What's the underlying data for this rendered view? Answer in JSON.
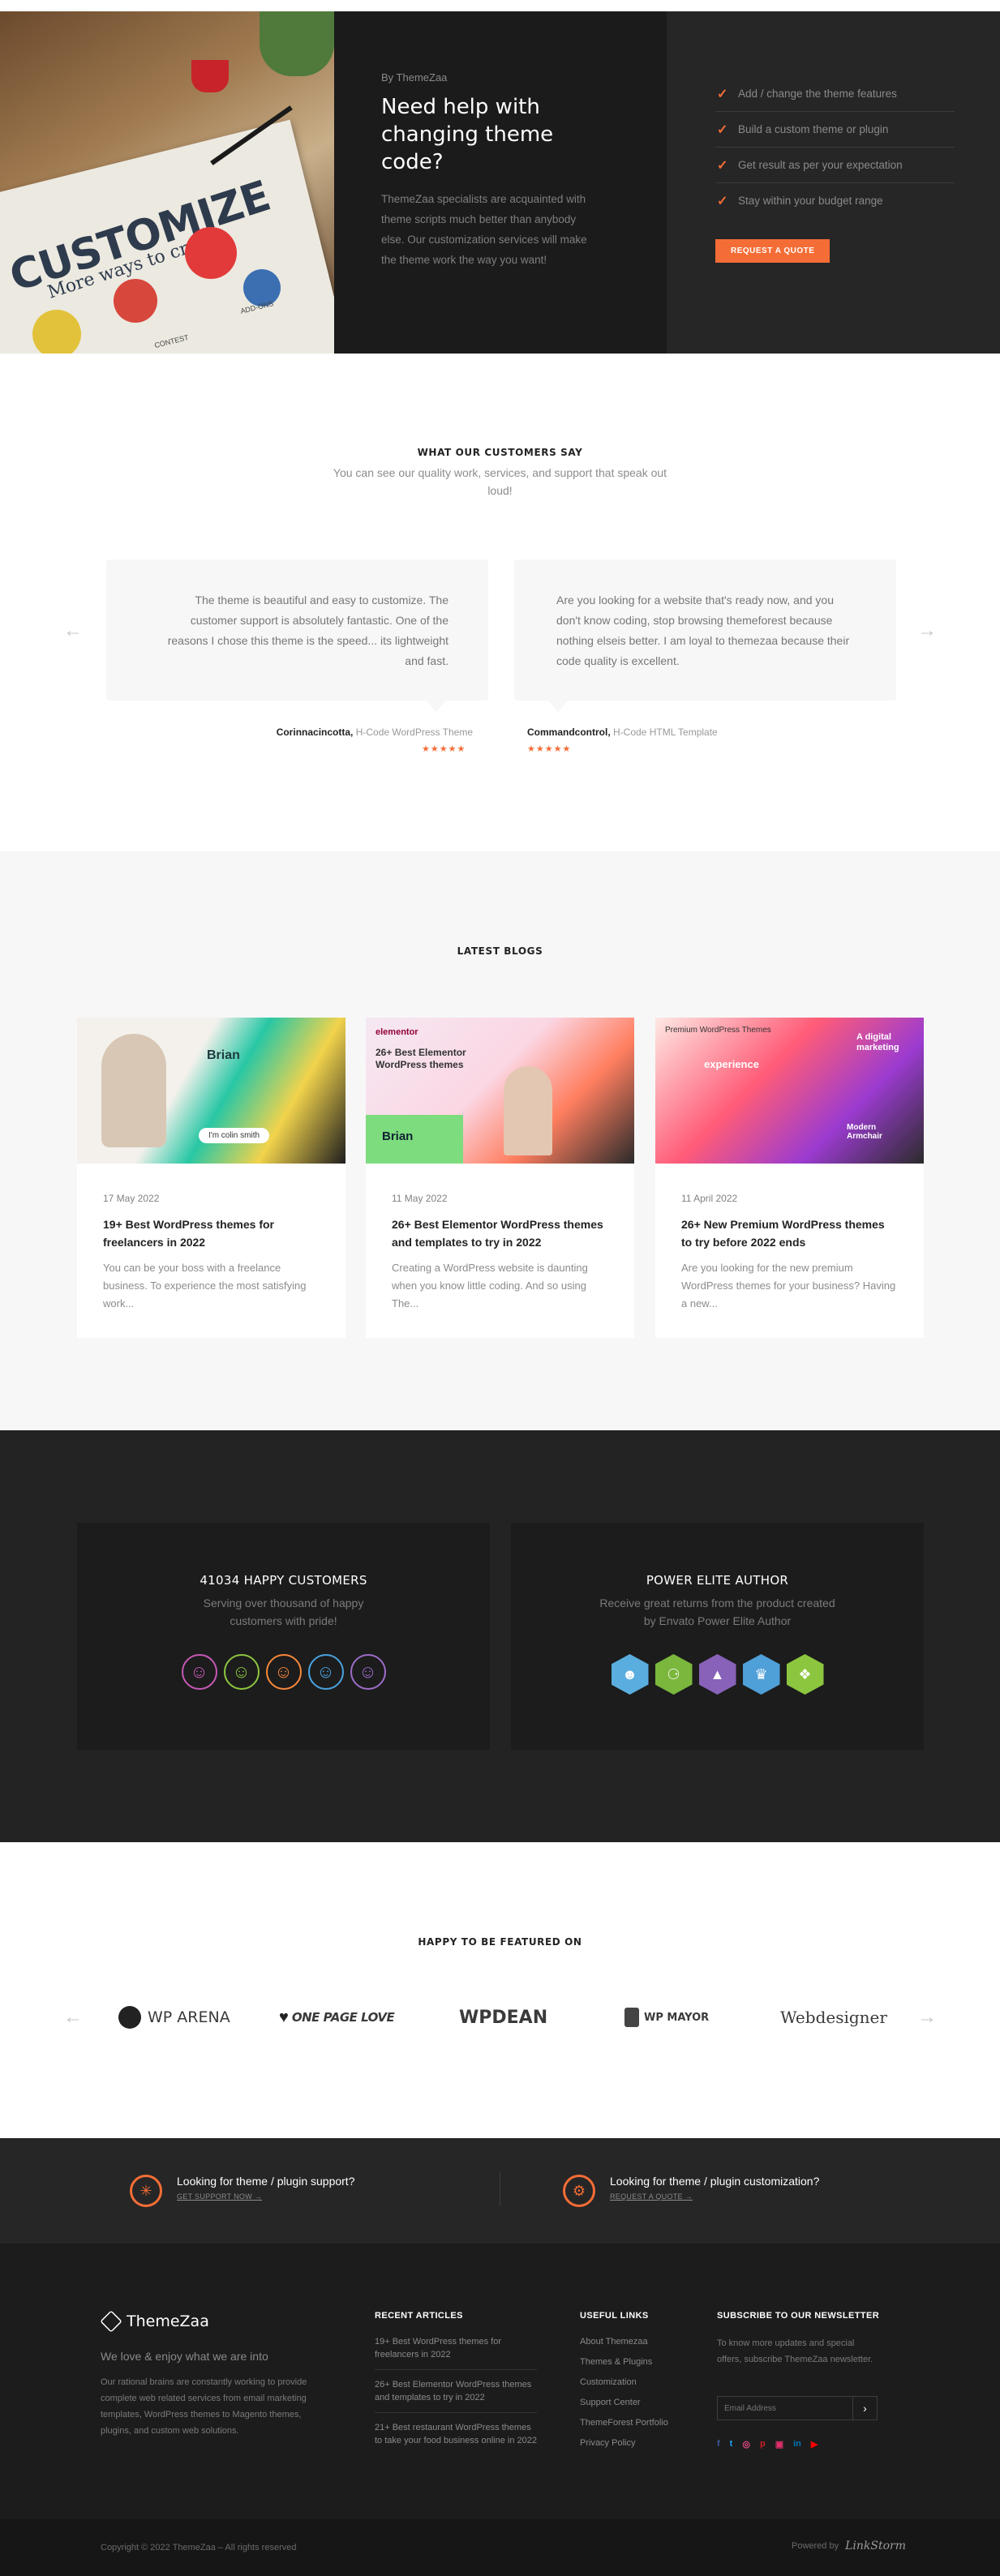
{
  "hero": {
    "image_text": {
      "big": "CUSTOMIZE",
      "small": "More ways to create",
      "addons": "ADD-ONS",
      "contest": "CONTEST"
    },
    "byline": "By ThemeZaa",
    "title": "Need help with changing theme code?",
    "description": "ThemeZaa specialists are acquainted with theme scripts much better than anybody else. Our customization services will make the theme work the way you want!",
    "features": [
      "Add / change the theme features",
      "Build a custom theme or plugin",
      "Get result as per your expectation",
      "Stay within your budget range"
    ],
    "cta": "REQUEST A QUOTE",
    "accent": "#f46d36"
  },
  "testimonials": {
    "heading": "WHAT OUR CUSTOMERS SAY",
    "subheading": "You can see our quality work, services, and support that speak out loud!",
    "items": [
      {
        "text": "The theme is beautiful and easy to customize. The customer support is absolutely fantastic. One of the reasons I chose this theme is the speed... its lightweight and fast.",
        "name": "Corinnacincotta,",
        "product": "H-Code WordPress Theme",
        "stars": "★★★★★"
      },
      {
        "text": "Are you looking for a website that's ready now, and you don't know coding, stop browsing themeforest because nothing elseis better. I am loyal to themezaa because their code quality is excellent.",
        "name": "Commandcontrol,",
        "product": "H-Code HTML Template",
        "stars": "★★★★★"
      }
    ],
    "prev_icon": "arrow-left-icon",
    "next_icon": "arrow-right-icon"
  },
  "blogs": {
    "heading": "LATEST BLOGS",
    "posts": [
      {
        "date": "17 May 2022",
        "title": "19+ Best WordPress themes for freelancers in 2022",
        "excerpt": "You can be your boss with a freelance business. To experience the most satisfying work...",
        "img_label": "Brian",
        "img_label2": "I'm colin smith"
      },
      {
        "date": "11 May 2022",
        "title": "26+ Best Elementor WordPress themes and templates to try in 2022",
        "excerpt": "Creating a WordPress website is daunting when you know little coding. And so using The...",
        "img_label": "elementor",
        "img_label2": "26+ Best Elementor WordPress themes",
        "img_label3": "Brian"
      },
      {
        "date": "11 April 2022",
        "title": "26+ New Premium WordPress themes to try before 2022 ends",
        "excerpt": "Are you looking for the new premium WordPress themes for your business? Having a new...",
        "img_label": "Premium WordPress Themes",
        "img_label2": "experience",
        "img_label3": "A digital marketing",
        "img_label4": "Modern Armchair"
      }
    ]
  },
  "stats": {
    "customers": {
      "title": "41034 HAPPY CUSTOMERS",
      "subtitle": "Serving over thousand of happy customers with pride!",
      "icons": [
        "face-cool-icon",
        "face-smile-icon",
        "face-grin-icon",
        "face-mustache-icon",
        "face-wink-icon"
      ],
      "colors": [
        "#c559b5",
        "#8dc63f",
        "#f6883c",
        "#4aa3df",
        "#9b6dc9"
      ]
    },
    "author": {
      "title": "POWER ELITE AUTHOR",
      "subtitle": "Receive great returns from the product created by Envato Power Elite Author",
      "icons": [
        "badge-user-icon",
        "badge-team-icon",
        "badge-rocket-icon",
        "badge-crown-icon",
        "badge-gift-icon"
      ],
      "colors": [
        "#5aaedf",
        "#7ab73c",
        "#8861b9",
        "#4f9fd8",
        "#8cc63f"
      ]
    }
  },
  "featured": {
    "heading": "HAPPY TO BE FEATURED ON",
    "logos": [
      "WP ARENA",
      "ONE PAGE LOVE",
      "WPDEAN",
      "WP MAYOR",
      "Webdesigner"
    ]
  },
  "support": {
    "items": [
      {
        "title": "Looking for theme / plugin support?",
        "link": "GET SUPPORT NOW",
        "icon": "lifebuoy-icon"
      },
      {
        "title": "Looking for theme / plugin customization?",
        "link": "REQUEST A QUOTE",
        "icon": "gear-icon"
      }
    ]
  },
  "footer": {
    "brand": "ThemeZaa",
    "tagline": "We love & enjoy what we are into",
    "about": "Our rational brains are constantly working to provide complete web related services from email marketing templates, WordPress themes to Magento themes, plugins, and custom web solutions.",
    "recent_heading": "RECENT ARTICLES",
    "recent": [
      "19+ Best WordPress themes for freelancers in 2022",
      "26+ Best Elementor WordPress themes and templates to try in 2022",
      "21+ Best restaurant WordPress themes to take your food business online in 2022"
    ],
    "links_heading": "USEFUL LINKS",
    "links": [
      "About Themezaa",
      "Themes & Plugins",
      "Customization",
      "Support Center",
      "ThemeForest Portfolio",
      "Privacy Policy"
    ],
    "newsletter_heading": "SUBSCRIBE TO OUR NEWSLETTER",
    "newsletter_text": "To know more updates and special offers, subscribe ThemeZaa newsletter.",
    "email_placeholder": "Email Address",
    "social": [
      "facebook-icon",
      "twitter-icon",
      "dribbble-icon",
      "pinterest-icon",
      "instagram-icon",
      "linkedin-icon",
      "youtube-icon"
    ],
    "social_colors": [
      "#3b5998",
      "#1da1f2",
      "#ea4c89",
      "#cb2027",
      "#e1306c",
      "#0077b5",
      "#ff0000"
    ],
    "copyright": "Copyright © 2022 ThemeZaa – All rights reserved",
    "powered_by": "Powered by",
    "powered_brand": "LinkStorm"
  }
}
